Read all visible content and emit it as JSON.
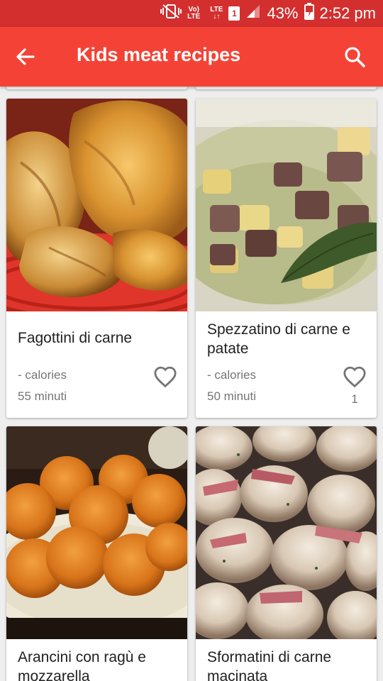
{
  "status_bar": {
    "volte_top": "Vo)",
    "volte_bottom": "LTE",
    "lte_top": "LTE",
    "lte_bottom": "↓↑",
    "sim_slot": "1",
    "battery_percent": "43%",
    "time": "2:52 pm",
    "icons": [
      "mute-vibrate-icon",
      "volte-icon",
      "lte-icon",
      "sim-icon",
      "signal-icon",
      "battery-charging-icon"
    ]
  },
  "toolbar": {
    "title": "Kids meat recipes",
    "back_icon": "arrow-back-icon",
    "search_icon": "search-icon",
    "color": "#f44336",
    "status_color": "#d32f2f"
  },
  "recipes": [
    {
      "title": "Fagottini di carne",
      "calories": "- calories",
      "time": "55 minuti",
      "likes": "",
      "image": "puff pastry parcels on red plate"
    },
    {
      "title": "Spezzatino di carne e patate",
      "calories": "- calories",
      "time": "50 minuti",
      "likes": "1",
      "image": "meat stew with potatoes and bay leaf"
    },
    {
      "title": "Arancini con ragù e mozzarella",
      "calories": "",
      "time": "",
      "likes": "",
      "image": "fried rice balls on plate"
    },
    {
      "title": "Sformatini di carne macinata",
      "calories": "",
      "time": "",
      "likes": "",
      "image": "baked minced meat bites with ham"
    }
  ]
}
